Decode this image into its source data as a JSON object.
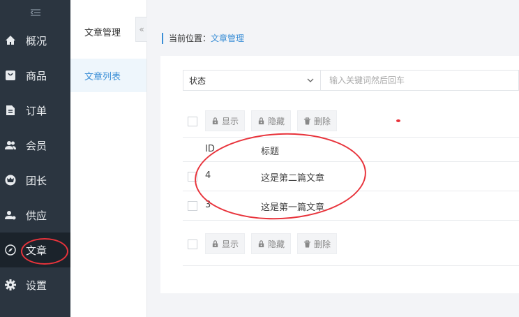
{
  "sidebar": {
    "items": [
      {
        "label": "概况",
        "icon": "home-icon"
      },
      {
        "label": "商品",
        "icon": "bag-icon"
      },
      {
        "label": "订单",
        "icon": "document-icon"
      },
      {
        "label": "会员",
        "icon": "users-icon"
      },
      {
        "label": "团长",
        "icon": "crown-icon"
      },
      {
        "label": "供应",
        "icon": "supplier-icon"
      },
      {
        "label": "文章",
        "icon": "compass-icon",
        "active": true
      },
      {
        "label": "设置",
        "icon": "gear-icon"
      }
    ]
  },
  "subnav": {
    "title": "文章管理",
    "items": [
      {
        "label": "文章列表",
        "active": true
      }
    ]
  },
  "breadcrumb": {
    "prefix": "当前位置：",
    "current": "文章管理"
  },
  "filter": {
    "status_label": "状态",
    "search_placeholder": "输入关键词然后回车"
  },
  "toolbar": {
    "show": "显示",
    "hide": "隐藏",
    "delete": "删除"
  },
  "table": {
    "headers": {
      "id": "ID",
      "title": "标题"
    },
    "rows": [
      {
        "id": "4",
        "title": "这是第二篇文章"
      },
      {
        "id": "3",
        "title": "这是第一篇文章"
      }
    ]
  },
  "colors": {
    "accent": "#3a8ed6",
    "sidebar_bg": "#2b3540",
    "annotation": "#e8333b"
  }
}
